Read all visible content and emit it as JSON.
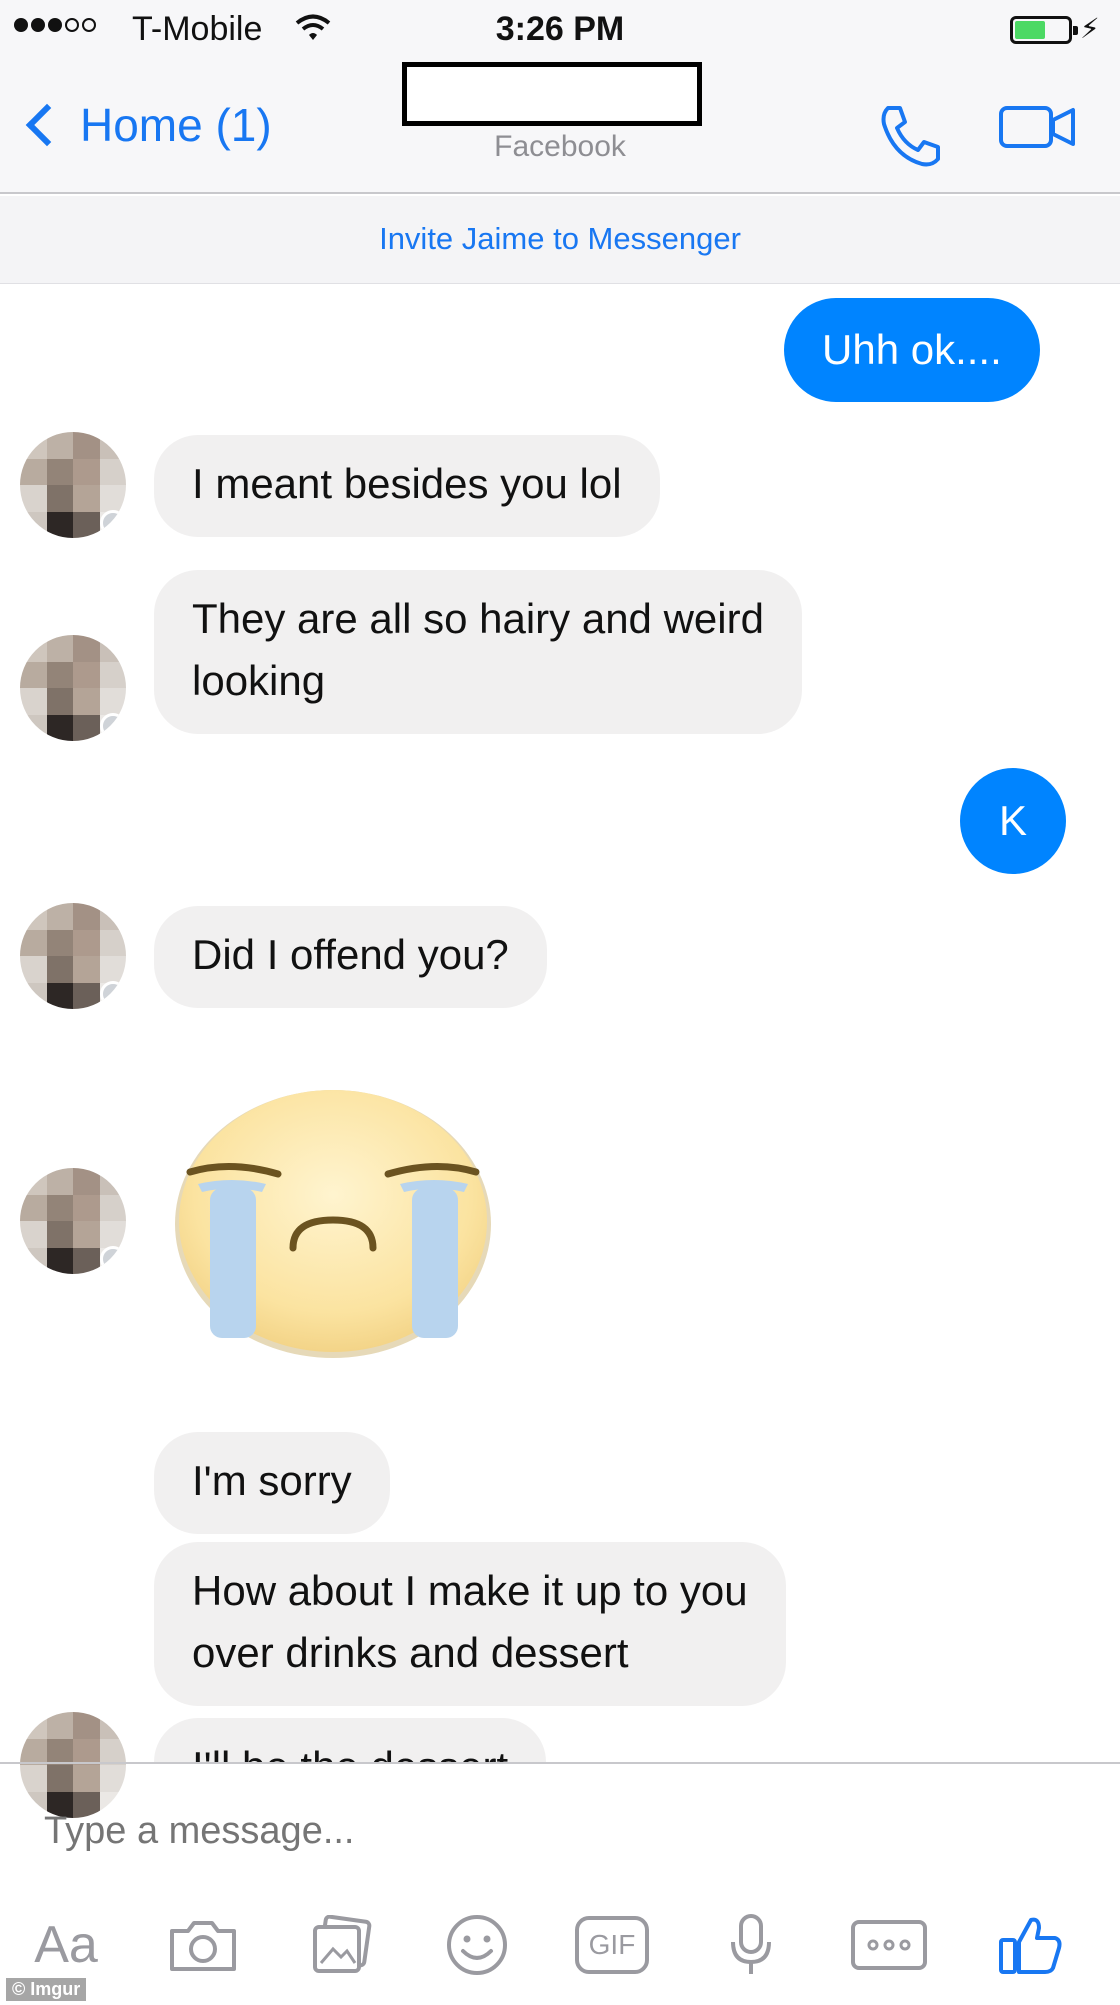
{
  "status_bar": {
    "carrier": "T-Mobile",
    "time": "3:26 PM",
    "battery_color": "#4cd964"
  },
  "nav": {
    "back_label": "Home (1)",
    "subtitle": "Facebook",
    "title_redacted": true,
    "accent": "#1877f2"
  },
  "invite_banner": "Invite Jaime to Messenger",
  "messages": [
    {
      "dir": "out",
      "text": "Uhh ok...."
    },
    {
      "dir": "in",
      "text": "I meant besides you lol"
    },
    {
      "dir": "in",
      "line1": "They are all so hairy and weird",
      "line2": "looking"
    },
    {
      "dir": "out",
      "text": "K"
    },
    {
      "dir": "in",
      "text": "Did I offend you?"
    },
    {
      "dir": "in",
      "sticker": "crying-face-emoji"
    },
    {
      "dir": "in",
      "text": "I'm sorry"
    },
    {
      "dir": "in",
      "line1": "How about I make it up to you",
      "line2": "over drinks and dessert"
    },
    {
      "dir": "in",
      "text": "I'll be the dessert",
      "partially_hidden": true
    }
  ],
  "composer": {
    "placeholder": "Type a message..."
  },
  "toolbar": {
    "text_label": "Aa",
    "gif_label": "GIF",
    "icons": [
      "camera-icon",
      "photo-icon",
      "emoji-icon",
      "gif-icon",
      "microphone-icon",
      "more-icon",
      "like-icon"
    ]
  },
  "watermark": "© Imgur",
  "colors": {
    "outgoing_bubble": "#0084ff",
    "incoming_bubble": "#f1f0f0"
  }
}
